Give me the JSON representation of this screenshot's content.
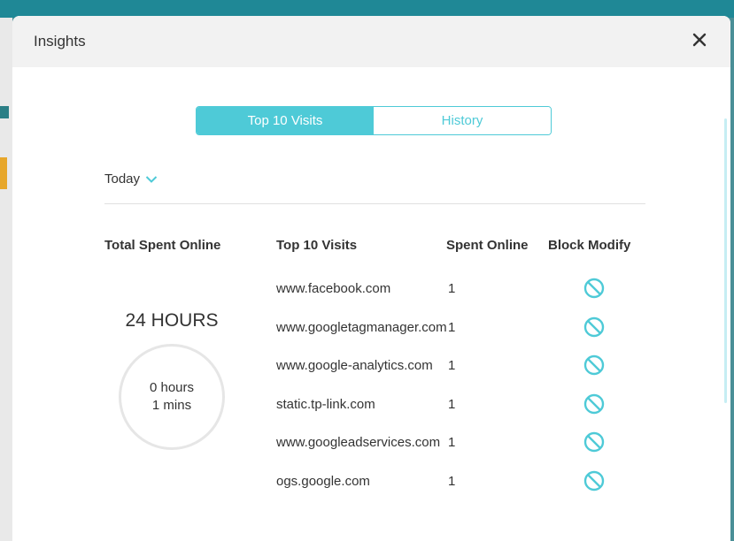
{
  "dialog": {
    "title": "Insights"
  },
  "tabs": [
    {
      "label": "Top 10 Visits",
      "active": true
    },
    {
      "label": "History",
      "active": false
    }
  ],
  "filter": {
    "selected": "Today"
  },
  "columns": {
    "total": "Total Spent Online",
    "visits": "Top 10 Visits",
    "spent": "Spent Online",
    "block": "Block Modify"
  },
  "summary": {
    "headline": "24 HOURS",
    "hours": "0 hours",
    "mins": "1 mins"
  },
  "rows": [
    {
      "site": "www.facebook.com",
      "spent": "1"
    },
    {
      "site": "www.googletagmanager.com",
      "spent": "1"
    },
    {
      "site": "www.google-analytics.com",
      "spent": "1"
    },
    {
      "site": "static.tp-link.com",
      "spent": "1"
    },
    {
      "site": "www.googleadservices.com",
      "spent": "1"
    },
    {
      "site": "ogs.google.com",
      "spent": "1"
    }
  ],
  "colors": {
    "accent": "#4ecad7",
    "text": "#333333",
    "header_bg": "#f2f2f2"
  },
  "icons": {
    "close": "close-icon",
    "block": "block-icon",
    "dropdown": "chevron-down-icon"
  }
}
